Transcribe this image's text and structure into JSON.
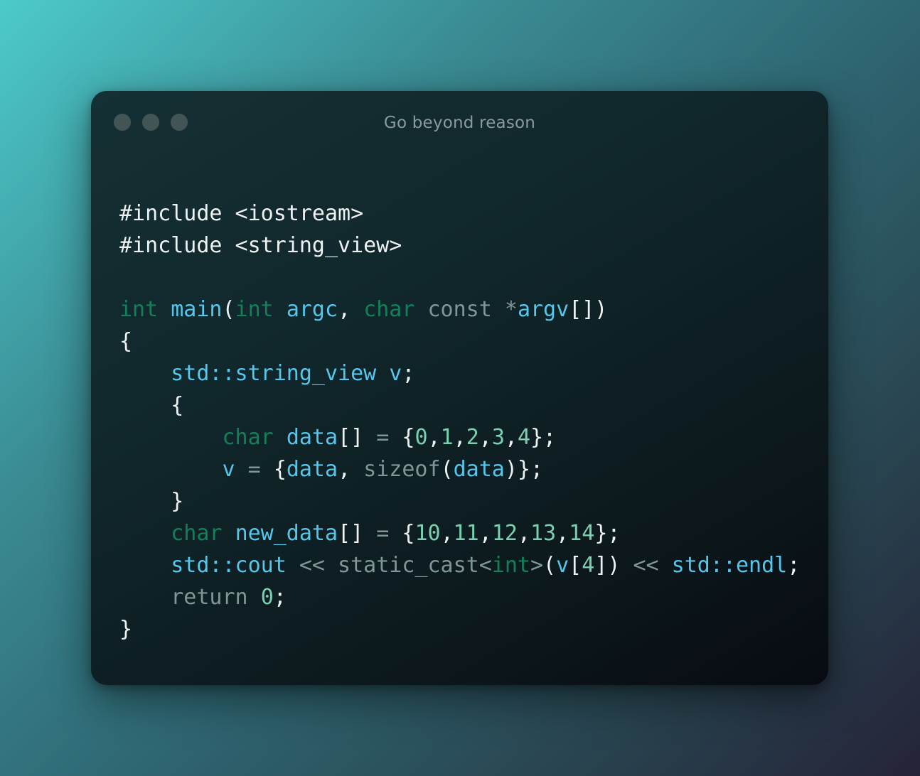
{
  "window": {
    "title": "Go beyond reason"
  },
  "colors": {
    "keyword": "#13805a",
    "identifier": "#56c6ec",
    "number": "#7ad0b0",
    "operator": "#809797",
    "plain": "#eef2f2"
  },
  "code": {
    "lines": [
      [
        {
          "t": "#include <iostream>",
          "c": "plain"
        }
      ],
      [
        {
          "t": "#include <string_view>",
          "c": "plain"
        }
      ],
      [],
      [
        {
          "t": "int",
          "c": "kw"
        },
        {
          "t": " ",
          "c": "plain"
        },
        {
          "t": "main",
          "c": "id"
        },
        {
          "t": "(",
          "c": "plain"
        },
        {
          "t": "int",
          "c": "kw"
        },
        {
          "t": " ",
          "c": "plain"
        },
        {
          "t": "argc",
          "c": "id"
        },
        {
          "t": ", ",
          "c": "plain"
        },
        {
          "t": "char",
          "c": "kw"
        },
        {
          "t": " const *",
          "c": "op"
        },
        {
          "t": "argv",
          "c": "id"
        },
        {
          "t": "[])",
          "c": "plain"
        }
      ],
      [
        {
          "t": "{",
          "c": "plain"
        }
      ],
      [
        {
          "t": "    ",
          "c": "plain"
        },
        {
          "t": "std::string_view v",
          "c": "id"
        },
        {
          "t": ";",
          "c": "plain"
        }
      ],
      [
        {
          "t": "    {",
          "c": "plain"
        }
      ],
      [
        {
          "t": "        ",
          "c": "plain"
        },
        {
          "t": "char",
          "c": "kw"
        },
        {
          "t": " ",
          "c": "plain"
        },
        {
          "t": "data",
          "c": "id"
        },
        {
          "t": "[] ",
          "c": "plain"
        },
        {
          "t": "=",
          "c": "op"
        },
        {
          "t": " {",
          "c": "plain"
        },
        {
          "t": "0",
          "c": "num"
        },
        {
          "t": ",",
          "c": "plain"
        },
        {
          "t": "1",
          "c": "num"
        },
        {
          "t": ",",
          "c": "plain"
        },
        {
          "t": "2",
          "c": "num"
        },
        {
          "t": ",",
          "c": "plain"
        },
        {
          "t": "3",
          "c": "num"
        },
        {
          "t": ",",
          "c": "plain"
        },
        {
          "t": "4",
          "c": "num"
        },
        {
          "t": "};",
          "c": "plain"
        }
      ],
      [
        {
          "t": "        ",
          "c": "plain"
        },
        {
          "t": "v",
          "c": "id"
        },
        {
          "t": " = ",
          "c": "op"
        },
        {
          "t": "{",
          "c": "plain"
        },
        {
          "t": "data",
          "c": "id"
        },
        {
          "t": ", ",
          "c": "plain"
        },
        {
          "t": "sizeof",
          "c": "op"
        },
        {
          "t": "(",
          "c": "plain"
        },
        {
          "t": "data",
          "c": "id"
        },
        {
          "t": ")};",
          "c": "plain"
        }
      ],
      [
        {
          "t": "    }",
          "c": "plain"
        }
      ],
      [
        {
          "t": "    ",
          "c": "plain"
        },
        {
          "t": "char",
          "c": "kw"
        },
        {
          "t": " ",
          "c": "plain"
        },
        {
          "t": "new_data",
          "c": "id"
        },
        {
          "t": "[] ",
          "c": "plain"
        },
        {
          "t": "=",
          "c": "op"
        },
        {
          "t": " {",
          "c": "plain"
        },
        {
          "t": "10",
          "c": "num"
        },
        {
          "t": ",",
          "c": "plain"
        },
        {
          "t": "11",
          "c": "num"
        },
        {
          "t": ",",
          "c": "plain"
        },
        {
          "t": "12",
          "c": "num"
        },
        {
          "t": ",",
          "c": "plain"
        },
        {
          "t": "13",
          "c": "num"
        },
        {
          "t": ",",
          "c": "plain"
        },
        {
          "t": "14",
          "c": "num"
        },
        {
          "t": "};",
          "c": "plain"
        }
      ],
      [
        {
          "t": "    ",
          "c": "plain"
        },
        {
          "t": "std::cout",
          "c": "id"
        },
        {
          "t": " << static_cast<",
          "c": "op"
        },
        {
          "t": "int",
          "c": "kw"
        },
        {
          "t": ">",
          "c": "op"
        },
        {
          "t": "(",
          "c": "plain"
        },
        {
          "t": "v",
          "c": "id"
        },
        {
          "t": "[",
          "c": "plain"
        },
        {
          "t": "4",
          "c": "num"
        },
        {
          "t": "]) ",
          "c": "plain"
        },
        {
          "t": "<<",
          "c": "op"
        },
        {
          "t": " ",
          "c": "plain"
        },
        {
          "t": "std::endl",
          "c": "id"
        },
        {
          "t": ";",
          "c": "plain"
        }
      ],
      [
        {
          "t": "    ",
          "c": "plain"
        },
        {
          "t": "return",
          "c": "op"
        },
        {
          "t": " ",
          "c": "plain"
        },
        {
          "t": "0",
          "c": "num"
        },
        {
          "t": ";",
          "c": "plain"
        }
      ],
      [
        {
          "t": "}",
          "c": "plain"
        }
      ]
    ]
  }
}
